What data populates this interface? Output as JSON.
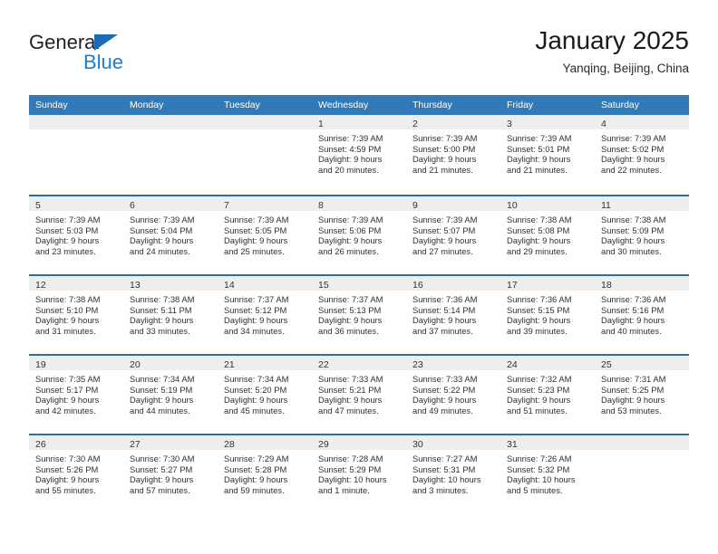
{
  "brand": {
    "name_top": "General",
    "name_bottom": "Blue",
    "triangle_color": "#1b6cb5",
    "blue_color": "#1b7fd4"
  },
  "header": {
    "title": "January 2025",
    "location": "Yanqing, Beijing, China"
  },
  "theme": {
    "header_bg": "#3279b7",
    "week_divider": "#2e6da4",
    "daynum_band": "#eeeeee",
    "text": "#303030"
  },
  "weekdays": [
    "Sunday",
    "Monday",
    "Tuesday",
    "Wednesday",
    "Thursday",
    "Friday",
    "Saturday"
  ],
  "weeks": [
    [
      {
        "day": "",
        "lines": []
      },
      {
        "day": "",
        "lines": []
      },
      {
        "day": "",
        "lines": []
      },
      {
        "day": "1",
        "lines": [
          "Sunrise: 7:39 AM",
          "Sunset: 4:59 PM",
          "Daylight: 9 hours",
          "and 20 minutes."
        ]
      },
      {
        "day": "2",
        "lines": [
          "Sunrise: 7:39 AM",
          "Sunset: 5:00 PM",
          "Daylight: 9 hours",
          "and 21 minutes."
        ]
      },
      {
        "day": "3",
        "lines": [
          "Sunrise: 7:39 AM",
          "Sunset: 5:01 PM",
          "Daylight: 9 hours",
          "and 21 minutes."
        ]
      },
      {
        "day": "4",
        "lines": [
          "Sunrise: 7:39 AM",
          "Sunset: 5:02 PM",
          "Daylight: 9 hours",
          "and 22 minutes."
        ]
      }
    ],
    [
      {
        "day": "5",
        "lines": [
          "Sunrise: 7:39 AM",
          "Sunset: 5:03 PM",
          "Daylight: 9 hours",
          "and 23 minutes."
        ]
      },
      {
        "day": "6",
        "lines": [
          "Sunrise: 7:39 AM",
          "Sunset: 5:04 PM",
          "Daylight: 9 hours",
          "and 24 minutes."
        ]
      },
      {
        "day": "7",
        "lines": [
          "Sunrise: 7:39 AM",
          "Sunset: 5:05 PM",
          "Daylight: 9 hours",
          "and 25 minutes."
        ]
      },
      {
        "day": "8",
        "lines": [
          "Sunrise: 7:39 AM",
          "Sunset: 5:06 PM",
          "Daylight: 9 hours",
          "and 26 minutes."
        ]
      },
      {
        "day": "9",
        "lines": [
          "Sunrise: 7:39 AM",
          "Sunset: 5:07 PM",
          "Daylight: 9 hours",
          "and 27 minutes."
        ]
      },
      {
        "day": "10",
        "lines": [
          "Sunrise: 7:38 AM",
          "Sunset: 5:08 PM",
          "Daylight: 9 hours",
          "and 29 minutes."
        ]
      },
      {
        "day": "11",
        "lines": [
          "Sunrise: 7:38 AM",
          "Sunset: 5:09 PM",
          "Daylight: 9 hours",
          "and 30 minutes."
        ]
      }
    ],
    [
      {
        "day": "12",
        "lines": [
          "Sunrise: 7:38 AM",
          "Sunset: 5:10 PM",
          "Daylight: 9 hours",
          "and 31 minutes."
        ]
      },
      {
        "day": "13",
        "lines": [
          "Sunrise: 7:38 AM",
          "Sunset: 5:11 PM",
          "Daylight: 9 hours",
          "and 33 minutes."
        ]
      },
      {
        "day": "14",
        "lines": [
          "Sunrise: 7:37 AM",
          "Sunset: 5:12 PM",
          "Daylight: 9 hours",
          "and 34 minutes."
        ]
      },
      {
        "day": "15",
        "lines": [
          "Sunrise: 7:37 AM",
          "Sunset: 5:13 PM",
          "Daylight: 9 hours",
          "and 36 minutes."
        ]
      },
      {
        "day": "16",
        "lines": [
          "Sunrise: 7:36 AM",
          "Sunset: 5:14 PM",
          "Daylight: 9 hours",
          "and 37 minutes."
        ]
      },
      {
        "day": "17",
        "lines": [
          "Sunrise: 7:36 AM",
          "Sunset: 5:15 PM",
          "Daylight: 9 hours",
          "and 39 minutes."
        ]
      },
      {
        "day": "18",
        "lines": [
          "Sunrise: 7:36 AM",
          "Sunset: 5:16 PM",
          "Daylight: 9 hours",
          "and 40 minutes."
        ]
      }
    ],
    [
      {
        "day": "19",
        "lines": [
          "Sunrise: 7:35 AM",
          "Sunset: 5:17 PM",
          "Daylight: 9 hours",
          "and 42 minutes."
        ]
      },
      {
        "day": "20",
        "lines": [
          "Sunrise: 7:34 AM",
          "Sunset: 5:19 PM",
          "Daylight: 9 hours",
          "and 44 minutes."
        ]
      },
      {
        "day": "21",
        "lines": [
          "Sunrise: 7:34 AM",
          "Sunset: 5:20 PM",
          "Daylight: 9 hours",
          "and 45 minutes."
        ]
      },
      {
        "day": "22",
        "lines": [
          "Sunrise: 7:33 AM",
          "Sunset: 5:21 PM",
          "Daylight: 9 hours",
          "and 47 minutes."
        ]
      },
      {
        "day": "23",
        "lines": [
          "Sunrise: 7:33 AM",
          "Sunset: 5:22 PM",
          "Daylight: 9 hours",
          "and 49 minutes."
        ]
      },
      {
        "day": "24",
        "lines": [
          "Sunrise: 7:32 AM",
          "Sunset: 5:23 PM",
          "Daylight: 9 hours",
          "and 51 minutes."
        ]
      },
      {
        "day": "25",
        "lines": [
          "Sunrise: 7:31 AM",
          "Sunset: 5:25 PM",
          "Daylight: 9 hours",
          "and 53 minutes."
        ]
      }
    ],
    [
      {
        "day": "26",
        "lines": [
          "Sunrise: 7:30 AM",
          "Sunset: 5:26 PM",
          "Daylight: 9 hours",
          "and 55 minutes."
        ]
      },
      {
        "day": "27",
        "lines": [
          "Sunrise: 7:30 AM",
          "Sunset: 5:27 PM",
          "Daylight: 9 hours",
          "and 57 minutes."
        ]
      },
      {
        "day": "28",
        "lines": [
          "Sunrise: 7:29 AM",
          "Sunset: 5:28 PM",
          "Daylight: 9 hours",
          "and 59 minutes."
        ]
      },
      {
        "day": "29",
        "lines": [
          "Sunrise: 7:28 AM",
          "Sunset: 5:29 PM",
          "Daylight: 10 hours",
          "and 1 minute."
        ]
      },
      {
        "day": "30",
        "lines": [
          "Sunrise: 7:27 AM",
          "Sunset: 5:31 PM",
          "Daylight: 10 hours",
          "and 3 minutes."
        ]
      },
      {
        "day": "31",
        "lines": [
          "Sunrise: 7:26 AM",
          "Sunset: 5:32 PM",
          "Daylight: 10 hours",
          "and 5 minutes."
        ]
      },
      {
        "day": "",
        "lines": []
      }
    ]
  ]
}
